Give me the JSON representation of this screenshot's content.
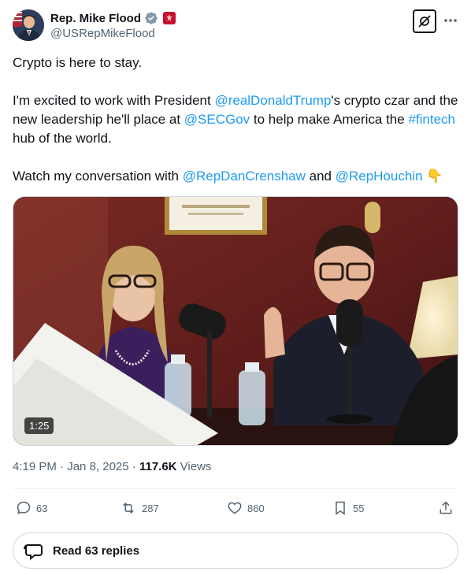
{
  "author": {
    "display_name": "Rep. Mike Flood",
    "handle": "@USRepMikeFlood",
    "avatar_icon": "profile-photo",
    "verified_icon": "verified-gray-badge-icon",
    "affiliation_icon": "us-house-seal-icon"
  },
  "tweet": {
    "line1": "Crypto is here to stay.",
    "p2_part1": "I'm excited to work with President ",
    "p2_mention1": "@realDonaldTrump",
    "p2_part2": "'s crypto czar and the new leadership he'll place at ",
    "p2_mention2": "@SECGov",
    "p2_part3": " to help make America the ",
    "p2_hashtag": "#fintech",
    "p2_part4": " hub of the world.",
    "p3_part1": "Watch my conversation with ",
    "p3_mention1": "@RepDanCrenshaw",
    "p3_part2": " and ",
    "p3_mention2": "@RepHouchin",
    "p3_emoji": "👇"
  },
  "media": {
    "type": "video",
    "duration": "1:25"
  },
  "meta": {
    "time": "4:19 PM",
    "sep1": " · ",
    "date": "Jan 8, 2025",
    "sep2": " · ",
    "views_count": "117.6K",
    "views_label": " Views"
  },
  "actions": {
    "replies": "63",
    "reposts": "287",
    "likes": "860",
    "bookmarks": "55"
  },
  "read_replies": {
    "label": "Read 63 replies"
  },
  "colors": {
    "link": "#1d9bf0",
    "text": "#0f1419",
    "secondary": "#536471",
    "border": "#cfd9de"
  }
}
